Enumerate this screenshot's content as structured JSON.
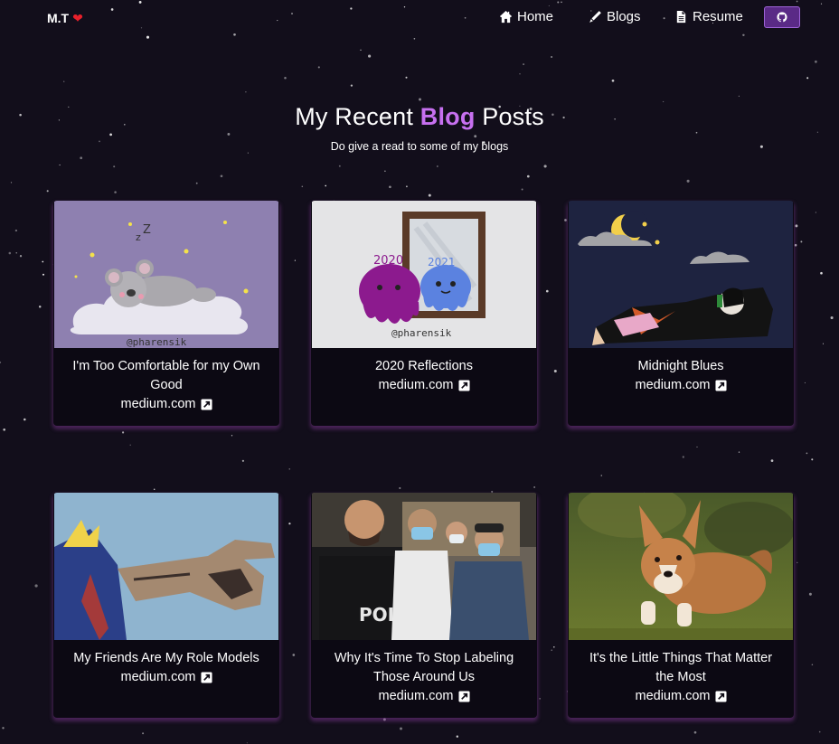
{
  "nav": {
    "brand": "M.T",
    "brand_icon": "heart-icon",
    "links": [
      {
        "label": "Home",
        "icon": "home-icon"
      },
      {
        "label": "Blogs",
        "icon": "pen-icon"
      },
      {
        "label": "Resume",
        "icon": "document-icon"
      }
    ],
    "github_icon": "github-icon"
  },
  "header": {
    "title_before": "My Recent ",
    "title_accent": "Blog",
    "title_after": " Posts",
    "subtitle": "Do give a read to some of my blogs"
  },
  "colors": {
    "background": "#120e1b",
    "accent": "#c770f0",
    "card_shadow": "#773588",
    "button_bg": "#5a2a86"
  },
  "posts": [
    {
      "title": "I'm Too Comfortable for my Own Good",
      "source": "medium.com",
      "image": "sleeping-koala-illustration",
      "image_caption": "@pharensik"
    },
    {
      "title": "2020 Reflections",
      "source": "medium.com",
      "image": "octopus-mirror-illustration",
      "image_caption": "@pharensik",
      "image_text_left": "2020",
      "image_text_right": "2021"
    },
    {
      "title": "Midnight Blues",
      "source": "medium.com",
      "image": "night-sky-sleeping-character-illustration"
    },
    {
      "title": "My Friends Are My Role Models",
      "source": "medium.com",
      "image": "anime-pointing-character-illustration"
    },
    {
      "title": "Why It's Time To Stop Labeling Those Around Us",
      "source": "medium.com",
      "image": "group-photo-police-officer",
      "image_text": "POLI"
    },
    {
      "title": "It's the Little Things That Matter the Most",
      "source": "medium.com",
      "image": "corgi-running-photo"
    }
  ]
}
